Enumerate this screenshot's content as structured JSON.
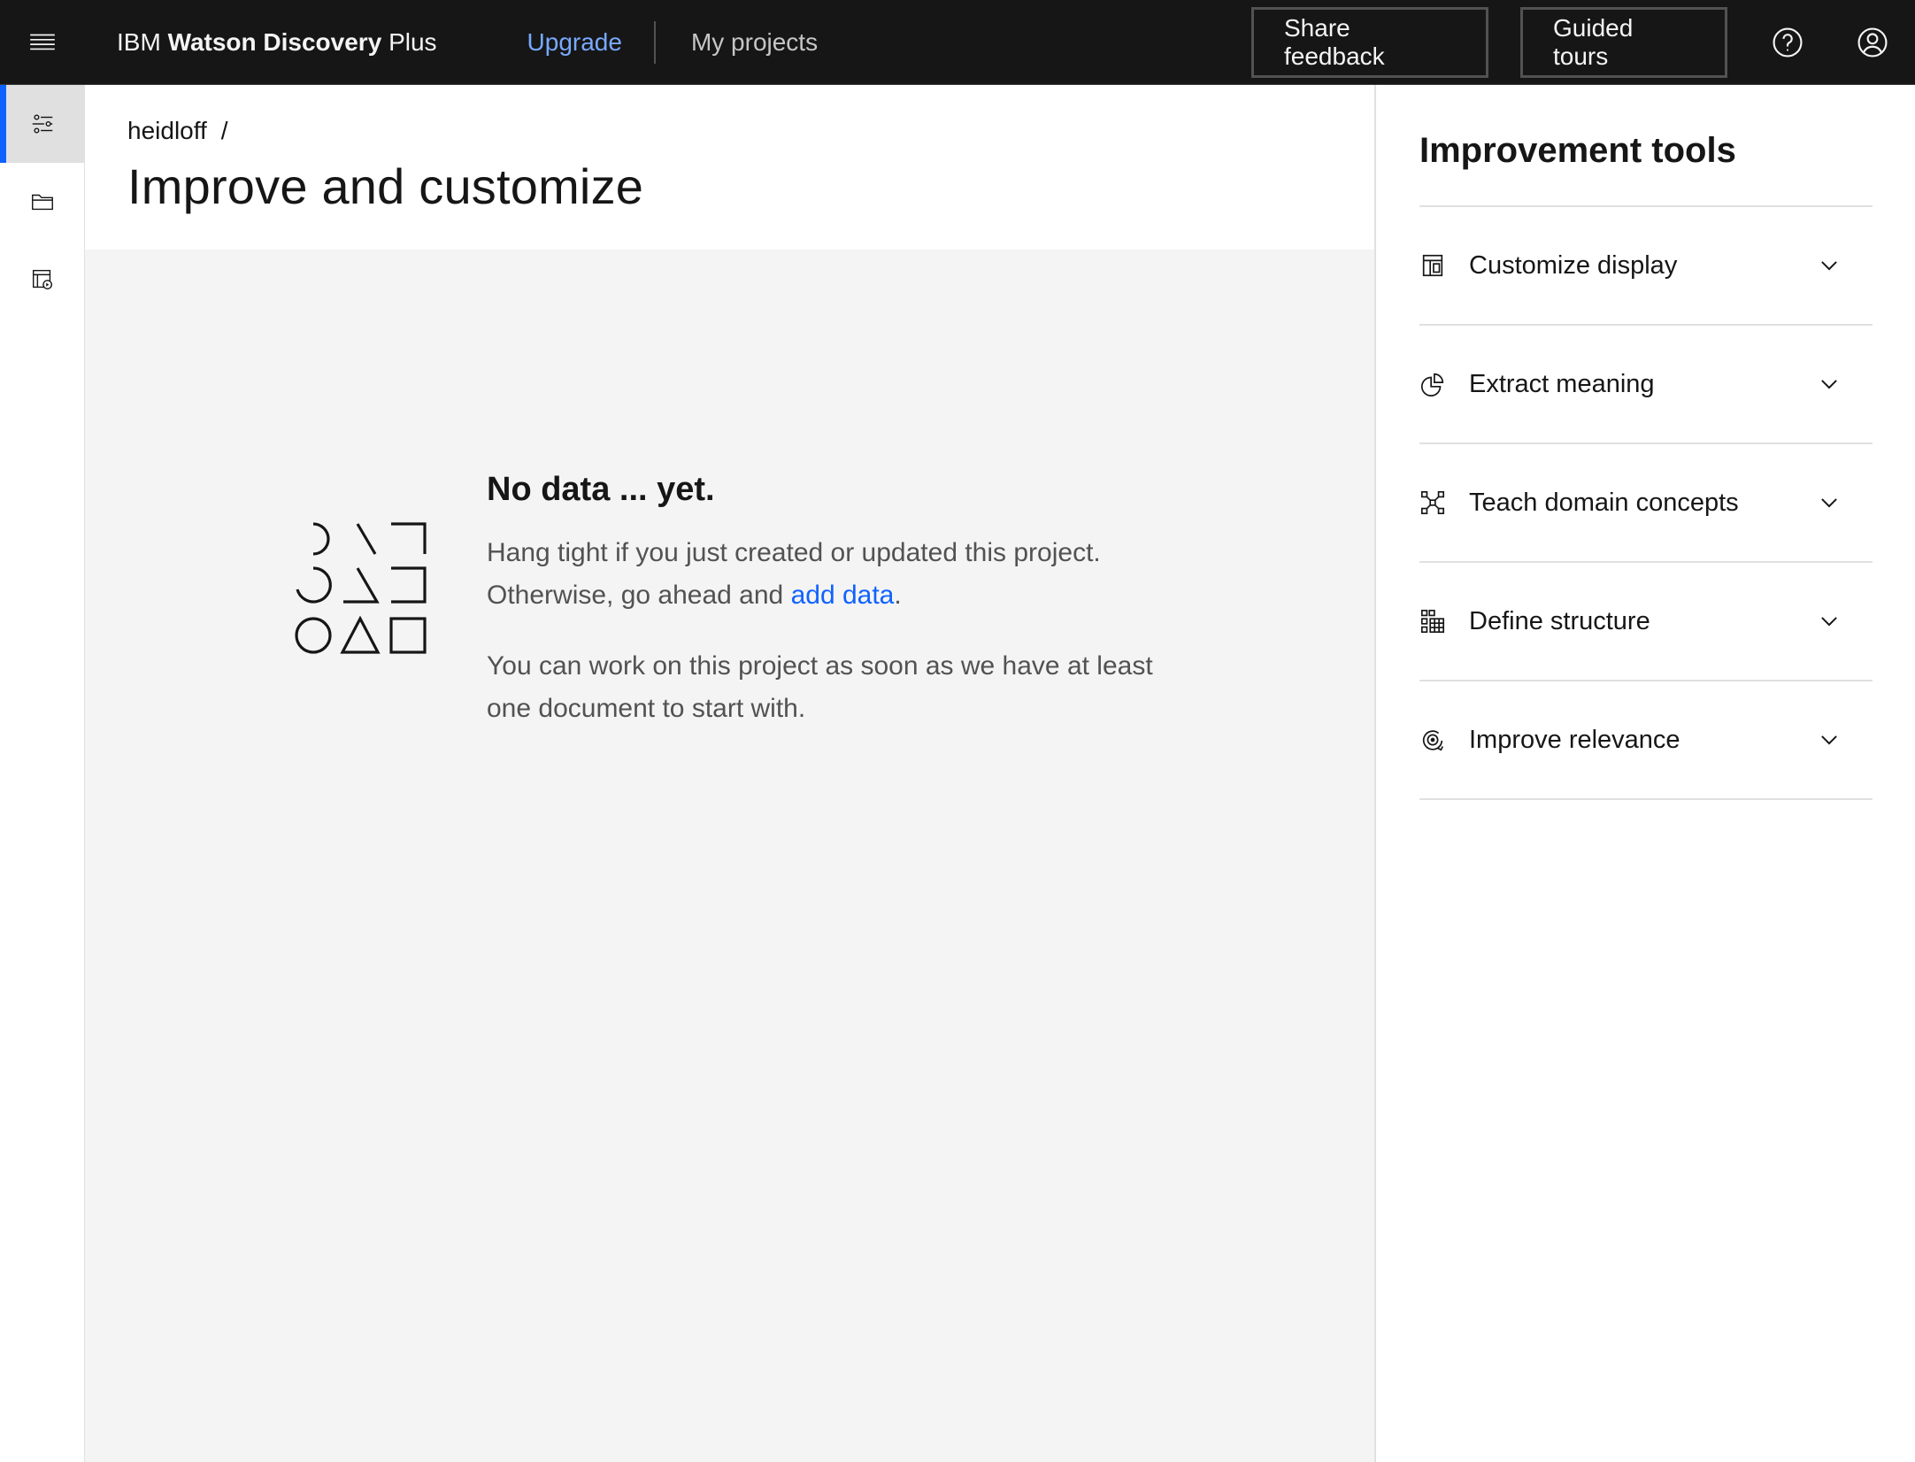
{
  "header": {
    "brand_prefix": "IBM",
    "brand_bold": "Watson Discovery",
    "brand_suffix": "Plus",
    "upgrade_label": "Upgrade",
    "my_projects_label": "My projects",
    "share_feedback_label": "Share feedback",
    "guided_tours_label": "Guided tours",
    "icons": [
      "hamburger-menu-icon",
      "help-icon",
      "user-avatar-icon"
    ]
  },
  "siderail": {
    "items": [
      {
        "icon": "settings-adjust-icon",
        "active": true
      },
      {
        "icon": "folder-icon",
        "active": false
      },
      {
        "icon": "data-sources-icon",
        "active": false
      }
    ]
  },
  "page": {
    "breadcrumb_project": "heidloff",
    "breadcrumb_separator": "/",
    "title": "Improve and customize"
  },
  "empty_state": {
    "title": "No data ... yet.",
    "line1": "Hang tight if you just created or updated this project.",
    "line2_prefix": "Otherwise, go ahead and ",
    "line2_link": "add data",
    "line2_suffix": ".",
    "paragraph2": "You can work on this project as soon as we have at least one document to start with."
  },
  "improvement_tools": {
    "title": "Improvement tools",
    "items": [
      {
        "label": "Customize display",
        "icon": "layout-icon"
      },
      {
        "label": "Extract meaning",
        "icon": "pie-chart-icon"
      },
      {
        "label": "Teach domain concepts",
        "icon": "network-icon"
      },
      {
        "label": "Define structure",
        "icon": "grid-structure-icon"
      },
      {
        "label": "Improve relevance",
        "icon": "target-icon"
      }
    ]
  },
  "colors": {
    "header_bg": "#161616",
    "accent": "#0f62fe",
    "upgrade_link": "#78a9ff",
    "main_bg": "#f4f4f4"
  }
}
